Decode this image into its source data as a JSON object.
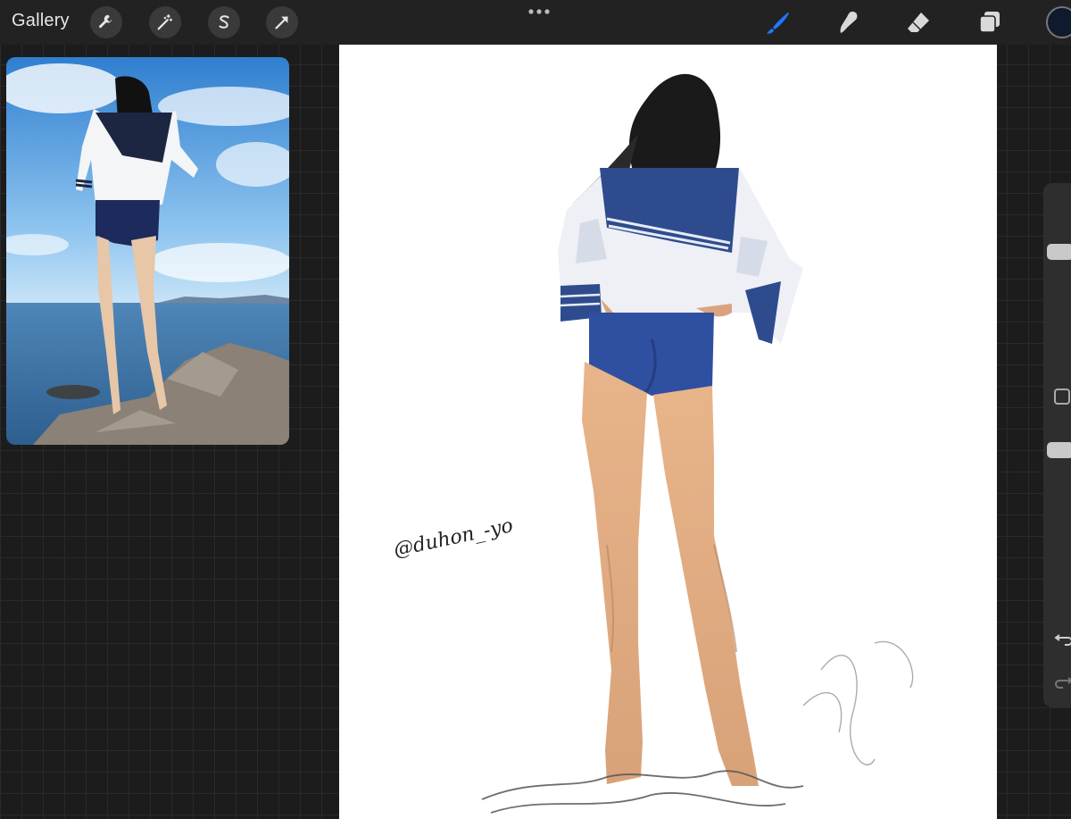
{
  "toolbar": {
    "gallery_label": "Gallery",
    "left_tools": [
      "wrench-icon",
      "magic-wand-icon",
      "selection-s-icon",
      "transform-arrow-icon"
    ],
    "right_tools": [
      "brush-icon",
      "smudge-icon",
      "eraser-icon",
      "layers-icon"
    ],
    "active_tool": "brush-icon",
    "accent_color": "#1e78ff",
    "current_color": "#0f1a2e"
  },
  "canvas": {
    "signature_text": "@duhon_-yo"
  },
  "sidebar": {
    "buttons": [
      "brush-size-slider",
      "modify-button",
      "opacity-slider",
      "undo-icon",
      "redo-icon"
    ]
  }
}
